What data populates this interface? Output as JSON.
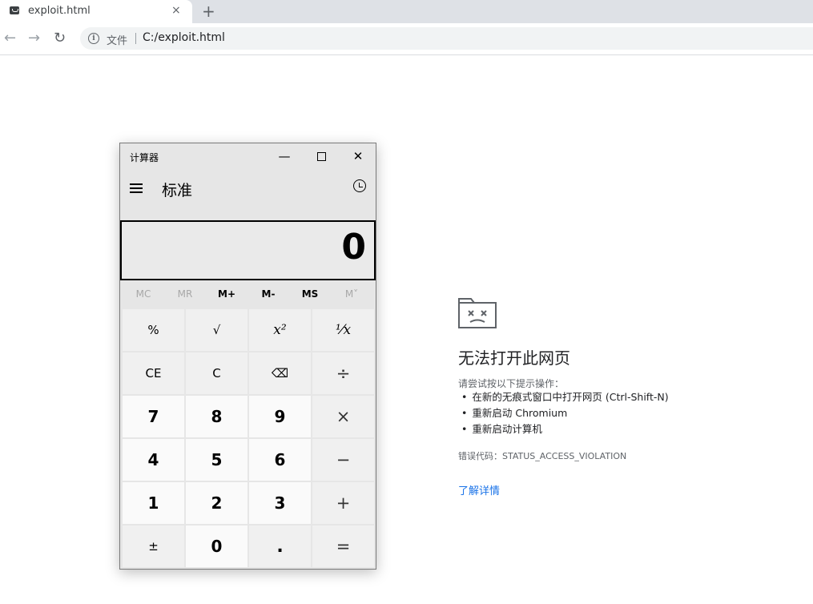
{
  "browser": {
    "tab": {
      "title": "exploit.html",
      "close": "×"
    },
    "newtab": "+",
    "nav": {
      "back": "←",
      "forward": "→",
      "reload": "↻"
    },
    "omnibox": {
      "scheme_label": "文件",
      "url": "C:/exploit.html"
    }
  },
  "calculator": {
    "window_title": "计算器",
    "mode": "标准",
    "display": "0",
    "memory": [
      "MC",
      "MR",
      "M+",
      "M-",
      "MS",
      "M˅"
    ],
    "memory_disabled": [
      true,
      true,
      false,
      false,
      false,
      true
    ],
    "keys": [
      [
        "%",
        "√",
        "x²",
        "¹⁄x"
      ],
      [
        "CE",
        "C",
        "⌫",
        "÷"
      ],
      [
        "7",
        "8",
        "9",
        "×"
      ],
      [
        "4",
        "5",
        "6",
        "−"
      ],
      [
        "1",
        "2",
        "3",
        "+"
      ],
      [
        "±",
        "0",
        ".",
        "="
      ]
    ]
  },
  "error_page": {
    "title": "无法打开此网页",
    "suggest_heading": "请尝试按以下提示操作：",
    "suggestions": [
      "在新的无痕式窗口中打开网页 (Ctrl-Shift-N)",
      "重新启动 Chromium",
      "重新启动计算机"
    ],
    "error_code": "错误代码：STATUS_ACCESS_VIOLATION",
    "learn_more": "了解详情",
    "link_color": "#1a73e8"
  }
}
